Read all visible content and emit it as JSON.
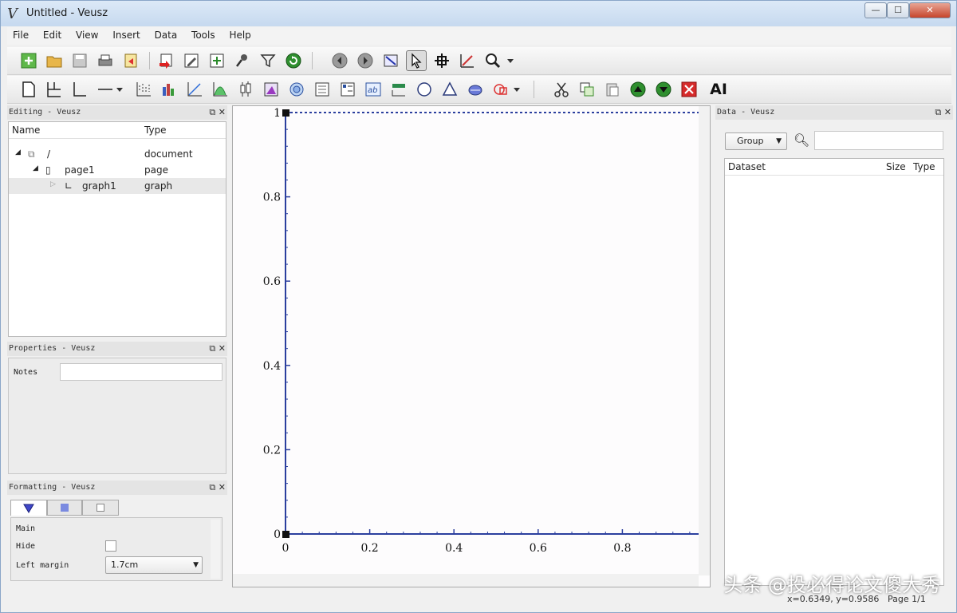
{
  "window": {
    "title": "Untitled - Veusz",
    "app_glyph": "V",
    "controls": {
      "minimize": "—",
      "maximize": "☐",
      "close": "✕"
    }
  },
  "menu": [
    "File",
    "Edit",
    "View",
    "Insert",
    "Data",
    "Tools",
    "Help"
  ],
  "toolbar_ai_label": "AI",
  "editing_panel": {
    "title": "Editing - Veusz",
    "columns": [
      "Name",
      "Type"
    ],
    "rows": [
      {
        "name": "/",
        "type": "document"
      },
      {
        "name": "page1",
        "type": "page"
      },
      {
        "name": "graph1",
        "type": "graph"
      }
    ]
  },
  "properties_panel": {
    "title": "Properties - Veusz",
    "notes_label": "Notes",
    "notes_value": ""
  },
  "formatting_panel": {
    "title": "Formatting - Veusz",
    "section_label": "Main",
    "hide_label": "Hide",
    "left_margin_label": "Left margin",
    "left_margin_value": "1.7cm"
  },
  "data_panel": {
    "title": "Data - Veusz",
    "group_button": "Group",
    "search_placeholder": "",
    "columns": [
      "Dataset",
      "Size",
      "Type"
    ]
  },
  "plot": {
    "y_ticks": [
      "0",
      "0.2",
      "0.4",
      "0.6",
      "0.8",
      "1"
    ],
    "x_ticks": [
      "0",
      "0.2",
      "0.4",
      "0.6",
      "0.8"
    ],
    "axis_color": "#2b3f9e"
  },
  "status": {
    "coords": "x=0.6349, y=0.9586",
    "page": "Page 1/1"
  },
  "watermark": "头条 @投必得论文傻大秀"
}
